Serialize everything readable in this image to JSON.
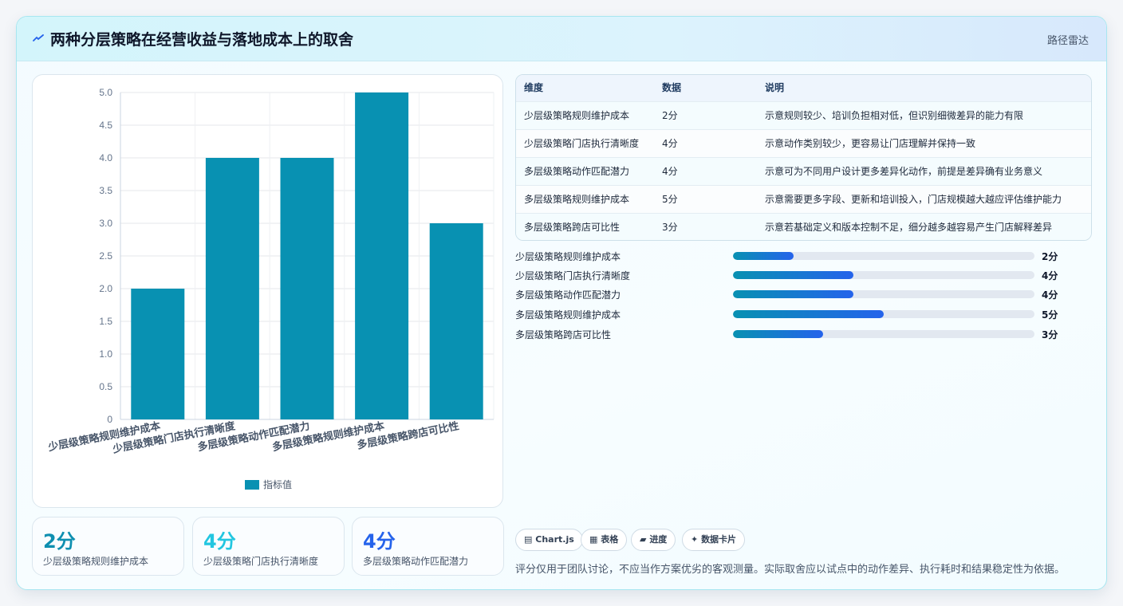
{
  "header": {
    "icon": "spark-icon",
    "title": "两种分层策略在经营收益与落地成本上的取舍",
    "right_label": "路径雷达"
  },
  "colors": {
    "bar": "#0891b2",
    "accent_teal": "#0e8fb0",
    "accent_cyan": "#22c6e0",
    "accent_blue": "#2563eb"
  },
  "chart_data": {
    "type": "bar",
    "categories": [
      "少层级策略规则维护成本",
      "少层级策略门店执行清晰度",
      "多层级策略动作匹配潜力",
      "多层级策略规则维护成本",
      "多层级策略跨店可比性"
    ],
    "series": [
      {
        "name": "指标值",
        "values": [
          2,
          4,
          4,
          5,
          3
        ]
      }
    ],
    "y_ticks": [
      "0",
      "0.5",
      "1.0",
      "1.5",
      "2.0",
      "2.5",
      "3.0",
      "3.5",
      "4.0",
      "4.5",
      "5.0"
    ],
    "ylim": [
      0,
      5
    ],
    "grid": true,
    "legend": "bottom"
  },
  "kpis": [
    {
      "value": "2分",
      "label": "少层级策略规则维护成本"
    },
    {
      "value": "4分",
      "label": "少层级策略门店执行清晰度"
    },
    {
      "value": "4分",
      "label": "多层级策略动作匹配潜力"
    }
  ],
  "table": {
    "headers": [
      "维度",
      "数据",
      "说明"
    ],
    "rows": [
      [
        "少层级策略规则维护成本",
        "2分",
        "示意规则较少、培训负担相对低，但识别细微差异的能力有限"
      ],
      [
        "少层级策略门店执行清晰度",
        "4分",
        "示意动作类别较少，更容易让门店理解并保持一致"
      ],
      [
        "多层级策略动作匹配潜力",
        "4分",
        "示意可为不同用户设计更多差异化动作，前提是差异确有业务意义"
      ],
      [
        "多层级策略规则维护成本",
        "5分",
        "示意需要更多字段、更新和培训投入，门店规模越大越应评估维护能力"
      ],
      [
        "多层级策略跨店可比性",
        "3分",
        "示意若基础定义和版本控制不足，细分越多越容易产生门店解释差异"
      ]
    ]
  },
  "progress": {
    "max": 10,
    "items": [
      {
        "label": "少层级策略规则维护成本",
        "value": 2,
        "text": "2分"
      },
      {
        "label": "少层级策略门店执行清晰度",
        "value": 4,
        "text": "4分"
      },
      {
        "label": "多层级策略动作匹配潜力",
        "value": 4,
        "text": "4分"
      },
      {
        "label": "多层级策略规则维护成本",
        "value": 5,
        "text": "5分"
      },
      {
        "label": "多层级策略跨店可比性",
        "value": 3,
        "text": "3分"
      }
    ]
  },
  "tags": [
    {
      "icon": "chart-icon",
      "glyph": "▤",
      "label": "Chart.js"
    },
    {
      "icon": "table-icon",
      "glyph": "▦",
      "label": "表格"
    },
    {
      "icon": "progress-icon",
      "glyph": "▰",
      "label": "进度"
    },
    {
      "icon": "sparkle-icon",
      "glyph": "✦",
      "label": "数据卡片"
    }
  ],
  "note": "评分仅用于团队讨论，不应当作方案优劣的客观测量。实际取舍应以试点中的动作差异、执行耗时和结果稳定性为依据。"
}
